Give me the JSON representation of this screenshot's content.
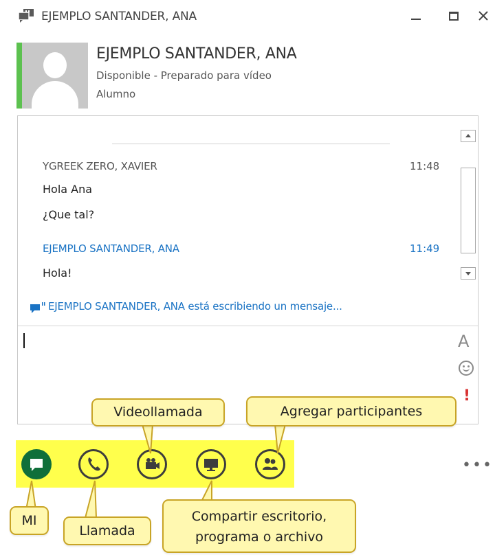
{
  "window": {
    "title": "EJEMPLO SANTANDER, ANA",
    "minimize_label": "–",
    "maximize_label": "□",
    "close_label": "✕"
  },
  "contact": {
    "name": "EJEMPLO SANTANDER, ANA",
    "status": "Disponible - Preparado para vídeo",
    "role": "Alumno",
    "presence_color": "#5cc14f"
  },
  "conversation": {
    "messages": [
      {
        "sender": "YGREEK ZERO, XAVIER",
        "time": "11:48",
        "lines": [
          "Hola Ana",
          "¿Que tal?"
        ]
      },
      {
        "sender": "EJEMPLO SANTANDER, ANA",
        "time": "11:49",
        "lines": [
          "Hola!"
        ]
      }
    ],
    "typing_indicator": "EJEMPLO SANTANDER, ANA está escribiendo un mensaje...",
    "self_color": "#1a73c4"
  },
  "compose": {
    "font_icon": "A",
    "emoji_icon": "smiley-icon",
    "priority_icon": "!"
  },
  "toolbar": {
    "highlight_color": "#ffff4c",
    "buttons": [
      {
        "name": "im",
        "icon": "chat-bubble-icon"
      },
      {
        "name": "call",
        "icon": "phone-icon"
      },
      {
        "name": "video",
        "icon": "video-camera-icon"
      },
      {
        "name": "share",
        "icon": "monitor-icon"
      },
      {
        "name": "participants",
        "icon": "people-icon"
      }
    ],
    "more_label": "•••"
  },
  "callouts": {
    "im": "MI",
    "call": "Llamada",
    "video": "Videollamada",
    "share_line1": "Compartir escritorio,",
    "share_line2": "programa o archivo",
    "participants": "Agregar participantes"
  }
}
